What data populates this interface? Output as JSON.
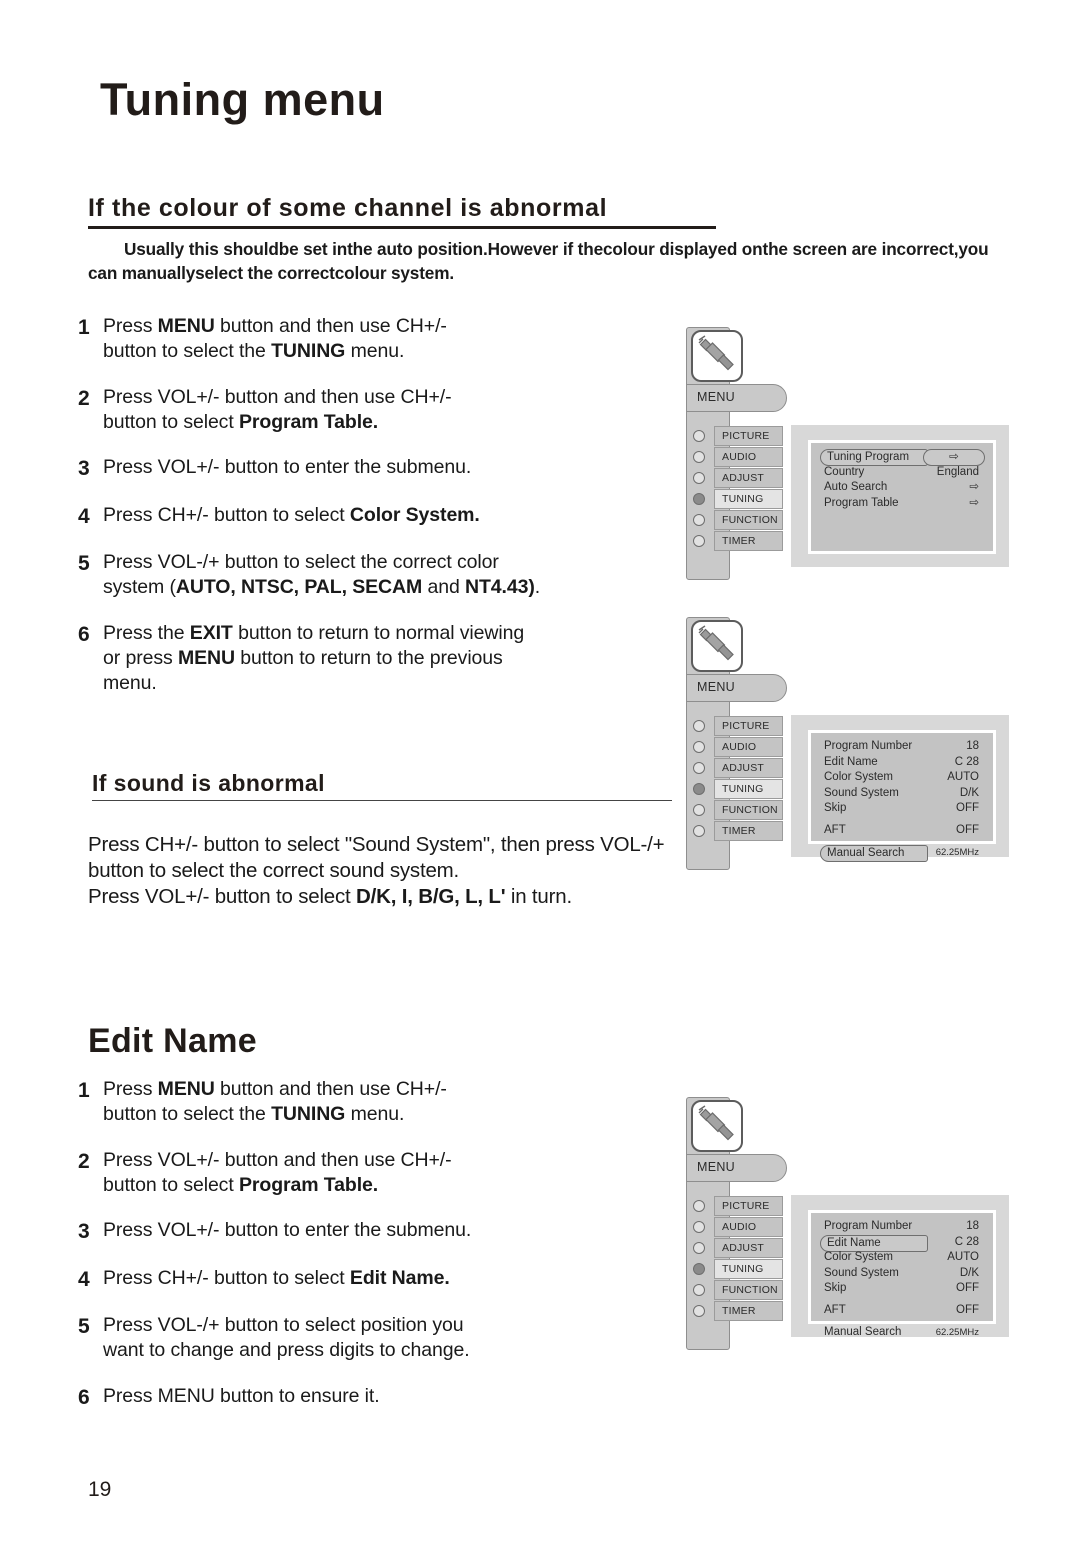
{
  "page": {
    "title": "Tuning menu",
    "number": "19"
  },
  "sections": {
    "colour": {
      "heading": "If the colour of some channel is abnormal",
      "intro": "Usually this shouldbe set inthe auto position.However if thecolour displayed onthe screen are incorrect,you can manuallyselect the correctcolour system."
    },
    "sound": {
      "heading": "If sound is abnormal",
      "para_line1_a": "Press CH+/- button  to select  \"Sound System\", then press VOL-/+ button to select the correct sound system.",
      "para_line2_a": "Press VOL+/- button to select ",
      "para_line2_b": "D/K, I, B/G, L, L'",
      "para_line2_c": " in turn."
    },
    "editname": {
      "heading": "Edit Name"
    }
  },
  "steps_colour": [
    {
      "num": "1",
      "parts": [
        {
          "t": "Press ",
          "b": false
        },
        {
          "t": "MENU",
          "b": true
        },
        {
          "t": " button and then use CH+/-",
          "b": false
        },
        {
          "t": "\nbutton to select the ",
          "b": false
        },
        {
          "t": "TUNING",
          "b": true
        },
        {
          "t": " menu.",
          "b": false
        }
      ]
    },
    {
      "num": "2",
      "parts": [
        {
          "t": "Press VOL+/- button and then use CH+/-",
          "b": false
        },
        {
          "t": "\nbutton to select ",
          "b": false
        },
        {
          "t": "Program Table.",
          "b": true
        }
      ]
    },
    {
      "num": "3",
      "parts": [
        {
          "t": "Press VOL+/- button to enter the submenu.",
          "b": false
        }
      ]
    },
    {
      "num": "4",
      "parts": [
        {
          "t": "Press CH+/- button to select ",
          "b": false
        },
        {
          "t": "Color System.",
          "b": true
        }
      ]
    },
    {
      "num": "5",
      "parts": [
        {
          "t": "Press VOL-/+ button to select the correct color",
          "b": false
        },
        {
          "t": "\nsystem (",
          "b": false
        },
        {
          "t": "AUTO, NTSC, PAL, SECAM",
          "b": true
        },
        {
          "t": " and ",
          "b": false
        },
        {
          "t": "NT4.43)",
          "b": true
        },
        {
          "t": ".",
          "b": false
        }
      ]
    },
    {
      "num": "6",
      "parts": [
        {
          "t": "Press the ",
          "b": false
        },
        {
          "t": "EXIT",
          "b": true
        },
        {
          "t": " button to return to normal viewing",
          "b": false
        },
        {
          "t": "\nor press ",
          "b": false
        },
        {
          "t": "MENU",
          "b": true
        },
        {
          "t": " button to return to the previous",
          "b": false
        },
        {
          "t": "\nmenu.",
          "b": false
        }
      ]
    }
  ],
  "steps_editname": [
    {
      "num": "1",
      "parts": [
        {
          "t": "Press ",
          "b": false
        },
        {
          "t": "MENU",
          "b": true
        },
        {
          "t": " button and then use CH+/-",
          "b": false
        },
        {
          "t": "\nbutton to select the ",
          "b": false
        },
        {
          "t": "TUNING",
          "b": true
        },
        {
          "t": " menu.",
          "b": false
        }
      ]
    },
    {
      "num": "2",
      "parts": [
        {
          "t": "Press VOL+/- button and then use CH+/-",
          "b": false
        },
        {
          "t": "\nbutton to select ",
          "b": false
        },
        {
          "t": "Program Table.",
          "b": true
        }
      ]
    },
    {
      "num": "3",
      "parts": [
        {
          "t": "Press VOL+/- button to enter the submenu.",
          "b": false
        }
      ]
    },
    {
      "num": "4",
      "parts": [
        {
          "t": "Press CH+/- button to select ",
          "b": false
        },
        {
          "t": "Edit Name.",
          "b": true
        }
      ]
    },
    {
      "num": "5",
      "parts": [
        {
          "t": "Press VOL-/+ button to select position you",
          "b": false
        },
        {
          "t": "\nwant to change and press digits to change.",
          "b": false
        }
      ]
    },
    {
      "num": "6",
      "parts": [
        {
          "t": "Press MENU button to ensure it.",
          "b": false
        }
      ]
    }
  ],
  "osd_common": {
    "menu_tab_label": "MENU",
    "menu_items": [
      {
        "label": "PICTURE",
        "active": false
      },
      {
        "label": "AUDIO",
        "active": false
      },
      {
        "label": "ADJUST",
        "active": false
      },
      {
        "label": "TUNING",
        "active": true
      },
      {
        "label": "FUNCTION",
        "active": false
      },
      {
        "label": "TIMER",
        "active": false
      }
    ],
    "icon_name": "tuner-plug-icon"
  },
  "osd_screens": [
    {
      "id": "tuning-program-screen",
      "rows": [
        {
          "label": "Tuning Program",
          "value": "⇨",
          "selected": true,
          "value_pill": true
        },
        {
          "label": "Country",
          "value": "England",
          "selected": false
        },
        {
          "label": "Auto Search",
          "value": "⇨",
          "selected": false
        },
        {
          "label": "Program Table",
          "value": "⇨",
          "selected": false
        }
      ]
    },
    {
      "id": "program-table-manual-search-screen",
      "rows": [
        {
          "label": "Program Number",
          "value": "18",
          "selected": false
        },
        {
          "label": "Edit Name",
          "value": "C 28",
          "selected": false
        },
        {
          "label": "Color System",
          "value": "AUTO",
          "selected": false
        },
        {
          "label": "Sound System",
          "value": "D/K",
          "selected": false
        },
        {
          "label": "Skip",
          "value": "OFF",
          "selected": false,
          "gap": true
        },
        {
          "label": "AFT",
          "value": "OFF",
          "selected": false,
          "gap": true
        },
        {
          "label": "Manual Search",
          "value": "62.25MHz",
          "selected": true,
          "gap": true,
          "small": true
        }
      ]
    },
    {
      "id": "program-table-edit-name-screen",
      "rows": [
        {
          "label": "Program Number",
          "value": "18",
          "selected": false
        },
        {
          "label": "Edit Name",
          "value": "C 28",
          "selected": true
        },
        {
          "label": "Color System",
          "value": "AUTO",
          "selected": false
        },
        {
          "label": "Sound System",
          "value": "D/K",
          "selected": false
        },
        {
          "label": "Skip",
          "value": "OFF",
          "selected": false,
          "gap": true
        },
        {
          "label": "AFT",
          "value": "OFF",
          "selected": false,
          "gap": true
        },
        {
          "label": "Manual Search",
          "value": "62.25MHz",
          "selected": false,
          "gap": true,
          "small": true
        }
      ]
    }
  ],
  "colors": {
    "text": "#1a1a1a",
    "osd_bar": "#c9c9c9",
    "osd_screen": "#d8d8d8",
    "osd_inner": "#c3c3c3",
    "osd_active": "#e4e4e4"
  }
}
